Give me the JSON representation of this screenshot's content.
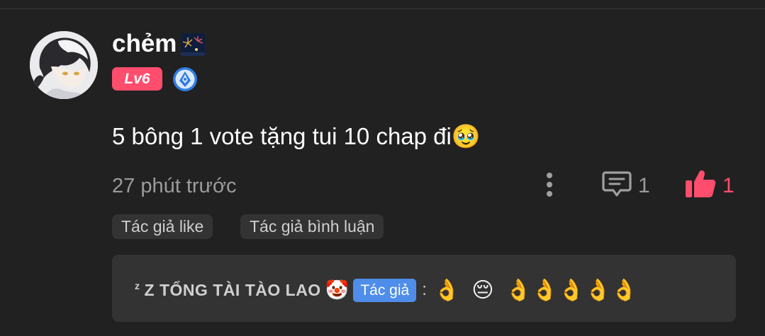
{
  "comment": {
    "username": "chẻm",
    "level_badge": "Lv6",
    "text": "5 bông 1 vote tặng tui 10 chap đi🥹",
    "time": "27 phút trước",
    "reply_count": "1",
    "like_count": "1",
    "tags": [
      "Tác giả like",
      "Tác giả bình luận"
    ]
  },
  "reply_preview": {
    "author_sup": "z",
    "author_name": "Z TỔNG TÀI TÀO LAO",
    "author_emoji": "🤡",
    "author_badge": "Tác giả",
    "separator": ":",
    "content_first": "👌",
    "content_second": "😔",
    "content_rest": "👌👌👌👌👌"
  },
  "icons": [
    "avatar",
    "fireworks-flair-icon",
    "creator-badge-icon",
    "more-icon",
    "reply-icon",
    "like-icon"
  ],
  "colors": {
    "background": "#212121",
    "level_badge": "#ff4d6d",
    "like": "#ff4d6d",
    "creator_badge": "#2f7de1",
    "author_badge": "#4f8dea",
    "muted_text": "#9b9b9b"
  }
}
